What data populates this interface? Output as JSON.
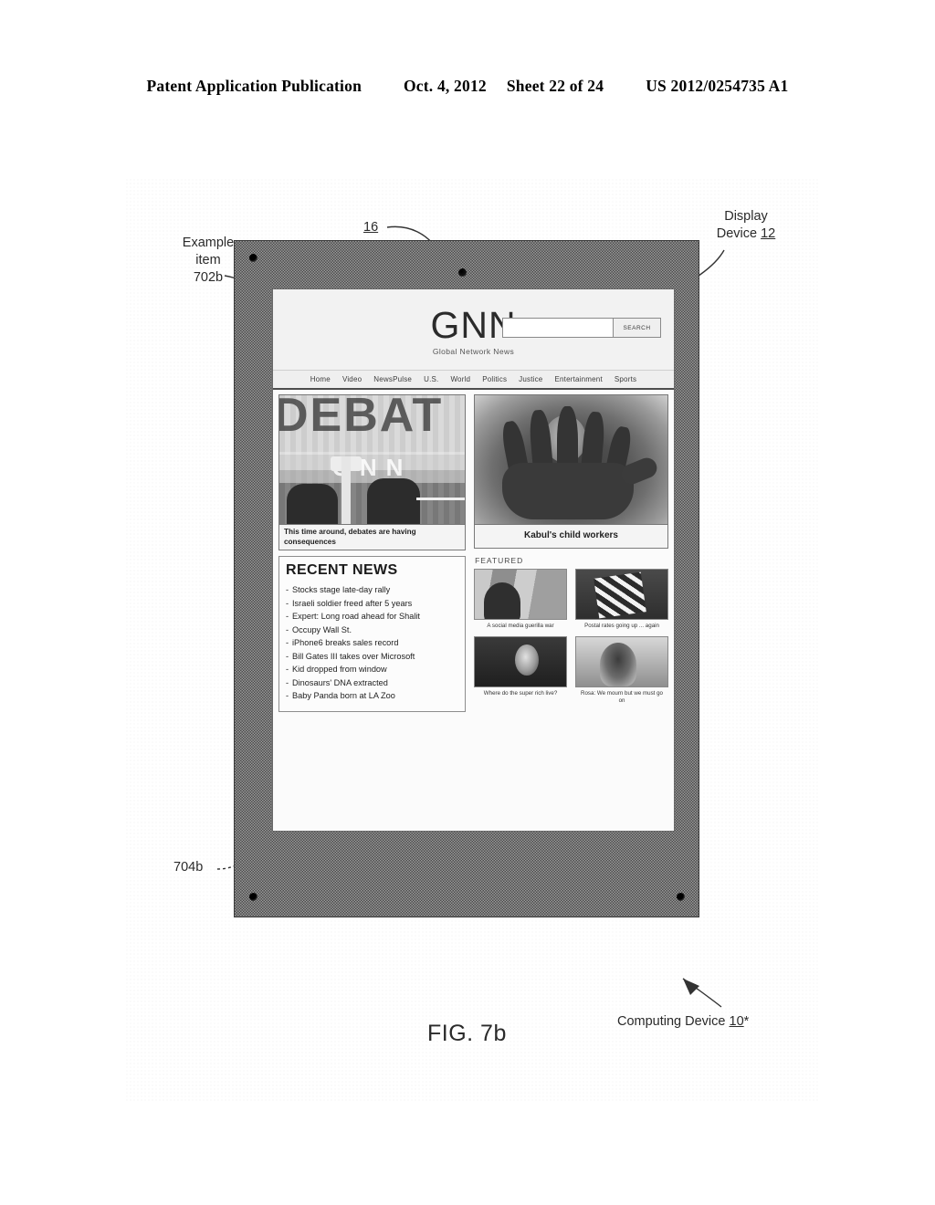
{
  "patent_header": {
    "publication": "Patent Application Publication",
    "date": "Oct. 4, 2012",
    "sheet": "Sheet 22 of 24",
    "number": "US 2012/0254735 A1"
  },
  "figure": {
    "caption": "FIG. 7b",
    "callouts": {
      "example_item": "Example\nitem\n702b",
      "ref_16": "16",
      "display_device_text": "Display\nDevice ",
      "display_device_num": "12",
      "ref_704b": "704b",
      "computing_device_text": "Computing Device ",
      "computing_device_num": "10",
      "computing_device_prime": "*"
    }
  },
  "screen": {
    "masthead": {
      "brand": "GNN",
      "tagline": "Global Network News",
      "search_value": "",
      "search_placeholder": "",
      "search_button": "SEARCH"
    },
    "nav": [
      {
        "label": "Home"
      },
      {
        "label": "Video"
      },
      {
        "label": "NewsPulse"
      },
      {
        "label": "U.S."
      },
      {
        "label": "World"
      },
      {
        "label": "Politics"
      },
      {
        "label": "Justice"
      },
      {
        "label": "Entertainment"
      },
      {
        "label": "Sports"
      }
    ],
    "hero_main": {
      "overlay_word": "DEBAT",
      "band_word": "GNN",
      "caption": "This time around, debates are having consequences"
    },
    "hero_side": {
      "caption": "Kabul's child workers"
    },
    "recent_news": {
      "title": "RECENT NEWS",
      "items": [
        {
          "text": "Stocks stage late-day rally"
        },
        {
          "text": "Israeli soldier freed after 5 years"
        },
        {
          "text": "Expert: Long road ahead for Shalit"
        },
        {
          "text": "Occupy Wall St."
        },
        {
          "text": "iPhone6 breaks sales record"
        },
        {
          "text": "Bill Gates III takes over Microsoft"
        },
        {
          "text": "Kid dropped from window"
        },
        {
          "text": "Dinosaurs' DNA extracted"
        },
        {
          "text": "Baby Panda born at LA Zoo"
        }
      ]
    },
    "featured": {
      "title": "FEATURED",
      "items": [
        {
          "caption": "A social media guerilla war"
        },
        {
          "caption": "Postal rates going up ... again"
        },
        {
          "caption": "Where do the super rich live?"
        },
        {
          "caption": "Rosa: We mourn but we must go on"
        }
      ]
    }
  }
}
